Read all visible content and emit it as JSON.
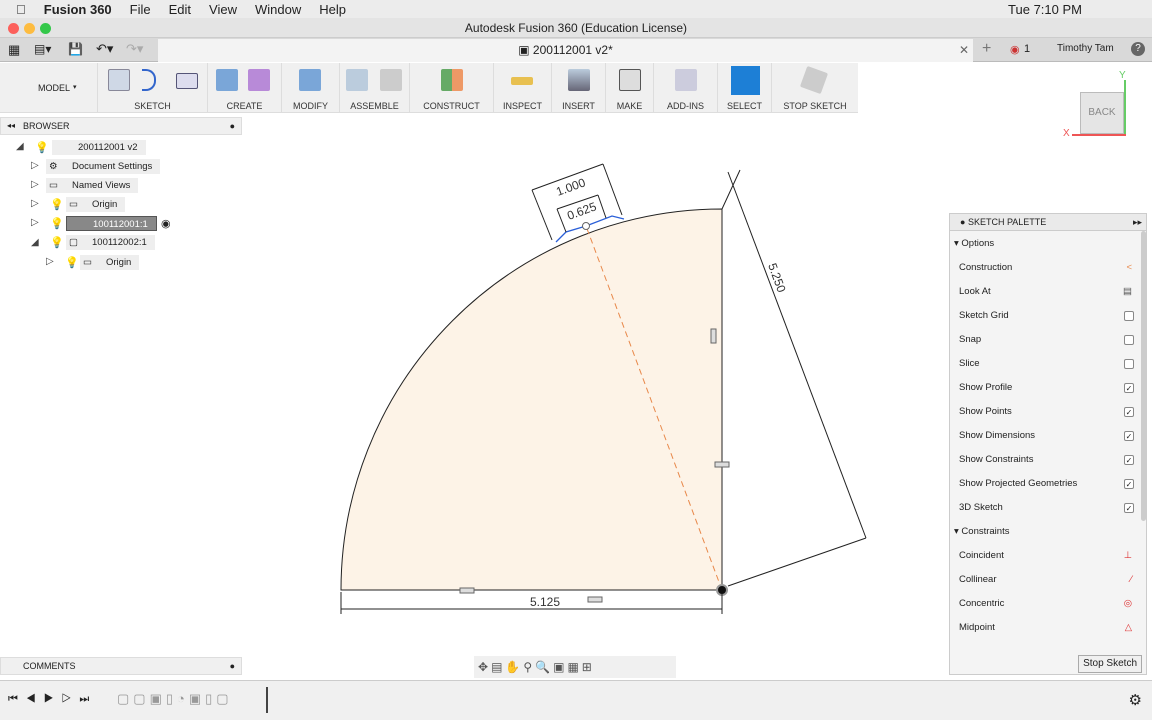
{
  "menubar": {
    "app": "Fusion 360",
    "items": [
      "File",
      "Edit",
      "View",
      "Window",
      "Help"
    ],
    "clock": "Tue 7:10 PM"
  },
  "window": {
    "title": "Autodesk Fusion 360 (Education License)"
  },
  "tab": {
    "title": "200112001 v2*",
    "notifications": "1",
    "user": "Timothy Tam"
  },
  "toolbar": {
    "workspace": "MODEL",
    "groups": [
      "SKETCH",
      "CREATE",
      "MODIFY",
      "ASSEMBLE",
      "CONSTRUCT",
      "INSPECT",
      "INSERT",
      "MAKE",
      "ADD-INS",
      "SELECT",
      "STOP SKETCH"
    ]
  },
  "viewcube": {
    "face": "BACK",
    "x": "X",
    "y": "Y"
  },
  "browser": {
    "title": "BROWSER",
    "nodes": [
      "200112001 v2",
      "Document Settings",
      "Named Views",
      "Origin",
      "100112001:1",
      "100112002:1",
      "Origin"
    ]
  },
  "comments": {
    "title": "COMMENTS"
  },
  "sketch": {
    "dims": {
      "bottom": "5.125",
      "diag": "5.250",
      "slot_len": "1.000",
      "slot_width": "0.625"
    },
    "fill": "#fdf3e7"
  },
  "palette": {
    "title": "SKETCH PALETTE",
    "options_header": "Options",
    "options": [
      {
        "label": "Construction",
        "type": "icon"
      },
      {
        "label": "Look At",
        "type": "icon"
      },
      {
        "label": "Sketch Grid",
        "checked": false
      },
      {
        "label": "Snap",
        "checked": false
      },
      {
        "label": "Slice",
        "checked": false
      },
      {
        "label": "Show Profile",
        "checked": true
      },
      {
        "label": "Show Points",
        "checked": true
      },
      {
        "label": "Show Dimensions",
        "checked": true
      },
      {
        "label": "Show Constraints",
        "checked": true
      },
      {
        "label": "Show Projected Geometries",
        "checked": true
      },
      {
        "label": "3D Sketch",
        "checked": true
      }
    ],
    "constraints_header": "Constraints",
    "constraints": [
      "Coincident",
      "Collinear",
      "Concentric",
      "Midpoint"
    ],
    "stop": "Stop Sketch"
  }
}
